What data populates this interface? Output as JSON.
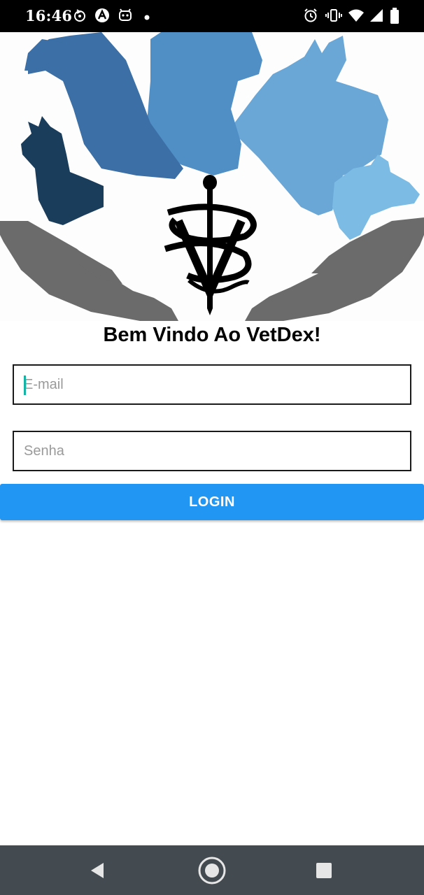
{
  "status_bar": {
    "time": "16:46",
    "left_icons": [
      "sync-icon",
      "android-app-icon",
      "robot-icon",
      "dot-icon"
    ],
    "right_icons": [
      "alarm-icon",
      "vibrate-icon",
      "wifi-icon",
      "signal-icon",
      "battery-icon"
    ]
  },
  "hero": {
    "image": "vet-logo-illustration",
    "colors": [
      "#3b6fa5",
      "#4f8fc6",
      "#6aa6d6",
      "#7bbbe4",
      "#1b3d5c",
      "#6b6b6b",
      "#000000"
    ]
  },
  "login": {
    "title": "Bem Vindo Ao VetDex!",
    "email_placeholder": "E-mail",
    "email_value": "",
    "password_placeholder": "Senha",
    "password_value": "",
    "button_label": "LOGIN",
    "button_color": "#2196f3"
  },
  "nav_bar": {
    "buttons": [
      "back-icon",
      "home-icon",
      "recents-icon"
    ]
  }
}
